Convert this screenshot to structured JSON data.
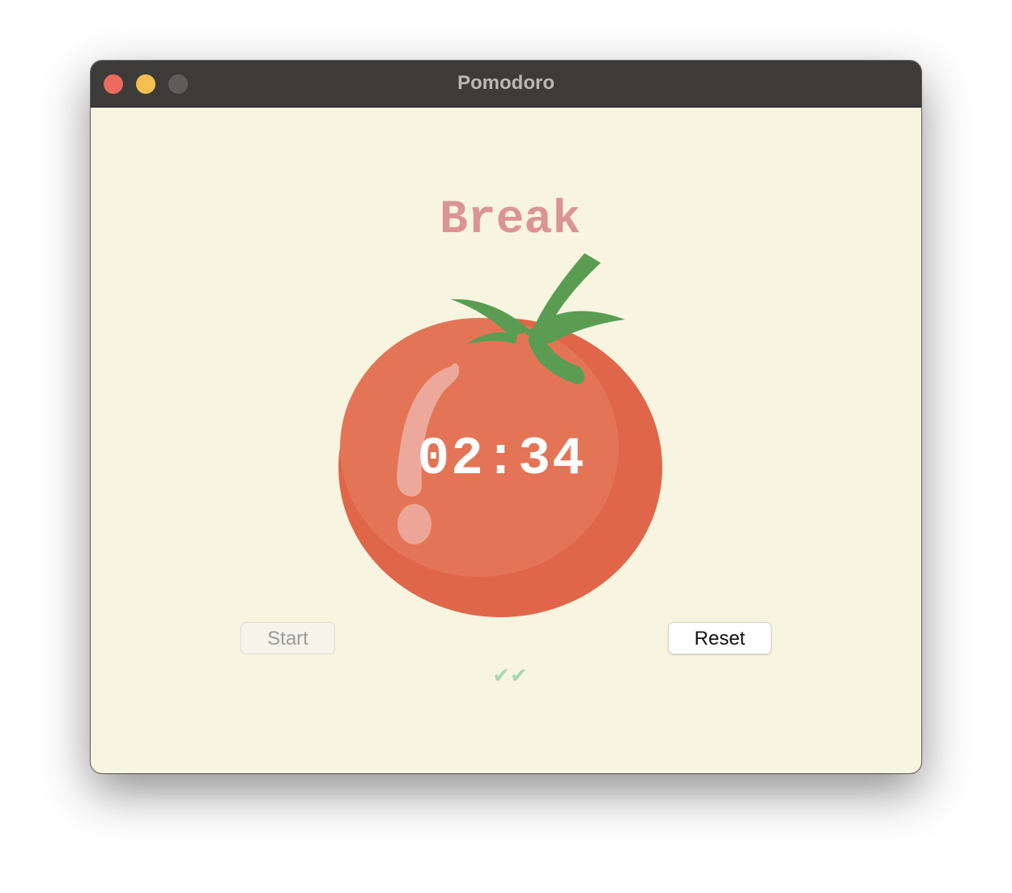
{
  "window": {
    "title": "Pomodoro"
  },
  "timer": {
    "mode_label": "Break",
    "time_remaining": "02:34",
    "check_marks": "✔✔"
  },
  "buttons": {
    "start_label": "Start",
    "reset_label": "Reset"
  },
  "colors": {
    "background": "#f7f4df",
    "mode_label": "#da9593",
    "tomato": "#e0664a",
    "stem": "#5a9d52",
    "checks": "#a8d8b4"
  },
  "icons": {
    "tomato": "tomato-image",
    "checks": "check-mark-icon"
  }
}
